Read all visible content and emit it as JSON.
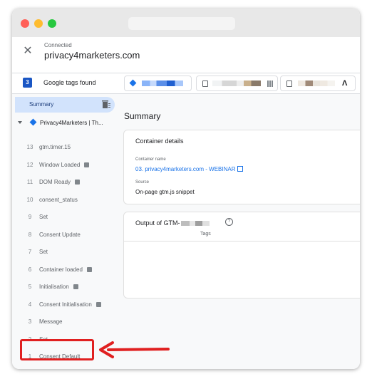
{
  "header": {
    "status_label": "Connected",
    "domain": "privacy4marketers.com"
  },
  "tags_bar": {
    "count": "3",
    "label": "Google tags found"
  },
  "sidebar": {
    "summary_label": "Summary",
    "container_label": "Privacy4Marketers | Th...",
    "events": [
      {
        "num": "13",
        "name": "gtm.timer.15",
        "badge": false
      },
      {
        "num": "12",
        "name": "Window Loaded",
        "badge": true
      },
      {
        "num": "11",
        "name": "DOM Ready",
        "badge": true
      },
      {
        "num": "10",
        "name": "consent_status",
        "badge": false
      },
      {
        "num": "9",
        "name": "Set",
        "badge": false
      },
      {
        "num": "8",
        "name": "Consent Update",
        "badge": false
      },
      {
        "num": "7",
        "name": "Set",
        "badge": false
      },
      {
        "num": "6",
        "name": "Container loaded",
        "badge": true
      },
      {
        "num": "5",
        "name": "Initialisation",
        "badge": true
      },
      {
        "num": "4",
        "name": "Consent Initialisation",
        "badge": true
      },
      {
        "num": "3",
        "name": "Message",
        "badge": false
      },
      {
        "num": "2",
        "name": "Set",
        "badge": false
      },
      {
        "num": "1",
        "name": "Consent Default",
        "badge": false
      }
    ]
  },
  "main": {
    "title": "Summary",
    "container_details": {
      "title": "Container details",
      "name_label": "Container name",
      "name_value": "03. privacy4marketers.com - WEBINAR",
      "source_label": "Source",
      "source_value": "On-page gtm.js snippet"
    },
    "output": {
      "title": "Output of GTM-",
      "tags_column": "Tags"
    }
  },
  "colors": {
    "accent": "#1a73e8",
    "highlight": "#e02020"
  }
}
